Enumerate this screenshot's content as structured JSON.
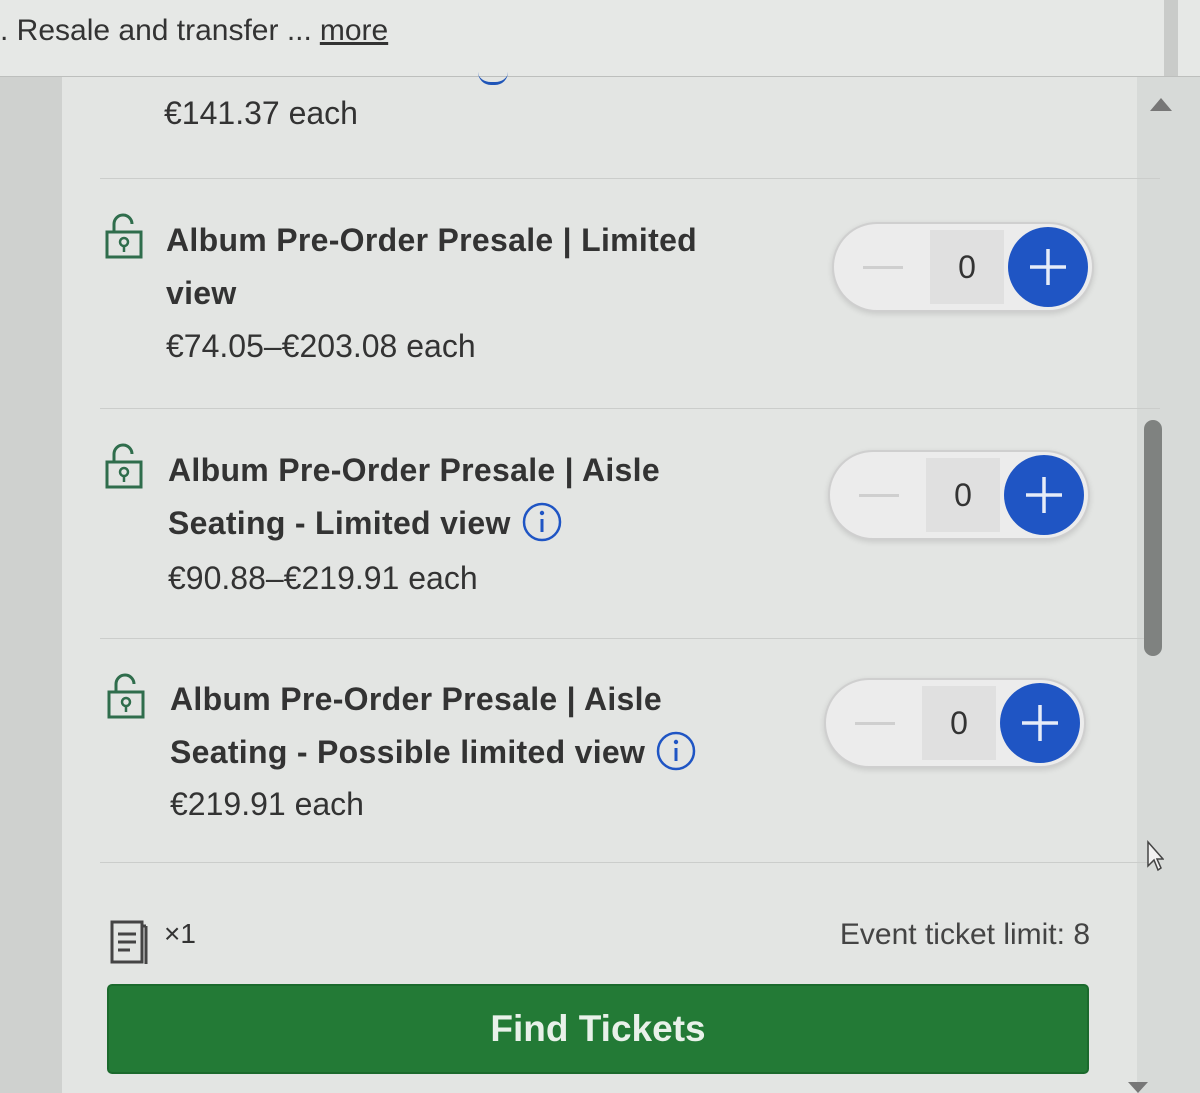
{
  "header": {
    "text": ". Resale and transfer ...",
    "more_label": "more"
  },
  "previous_item": {
    "price": "€141.37 each"
  },
  "ticket_rows": [
    {
      "icon": "lock-open-pin-icon",
      "title_line1": "Album Pre-Order Presale | Limited",
      "title_line2": "view",
      "has_info": false,
      "price": "€74.05–€203.08 each",
      "quantity": "0"
    },
    {
      "icon": "lock-open-pin-icon",
      "title_line1": "Album Pre-Order Presale | Aisle",
      "title_line2": "Seating - Limited view",
      "has_info": true,
      "price": "€90.88–€219.91 each",
      "quantity": "0"
    },
    {
      "icon": "lock-open-pin-icon",
      "title_line1": "Album Pre-Order Presale | Aisle",
      "title_line2": "Seating - Possible limited view",
      "has_info": true,
      "price": "€219.91 each",
      "quantity": "0"
    }
  ],
  "footer": {
    "ticket_count": "×1",
    "event_limit": "Event ticket limit: 8",
    "find_button_label": "Find Tickets"
  },
  "colors": {
    "accent_blue": "#1f55c4",
    "button_green": "#237a36"
  }
}
